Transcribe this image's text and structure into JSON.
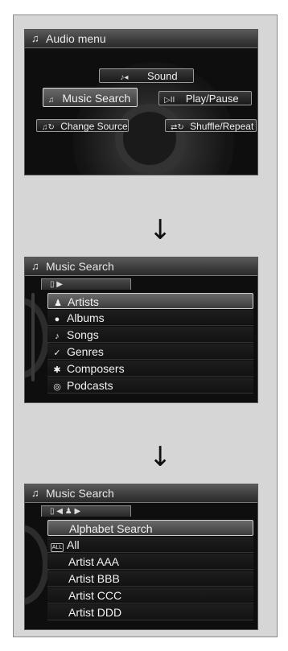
{
  "screen1": {
    "title": "Audio menu",
    "title_icon": "music-note-icon",
    "buttons": {
      "sound": {
        "label": "Sound",
        "icon": "♪◂"
      },
      "music_search": {
        "label": "Music Search",
        "icon": "♫"
      },
      "play_pause": {
        "label": "Play/Pause",
        "icon": "▷II"
      },
      "change_source": {
        "label": "Change Source",
        "icon": "♫↻"
      },
      "shuffle_repeat": {
        "label": "Shuffle/Repeat",
        "icon": "⇄↻"
      }
    }
  },
  "arrow1": "↓",
  "screen2": {
    "title": "Music Search",
    "title_icon": "music-note-icon",
    "tab_icon": "▯  ▶",
    "items": [
      {
        "label": "Artists",
        "icon": "♟"
      },
      {
        "label": "Albums",
        "icon": "●"
      },
      {
        "label": "Songs",
        "icon": "♪"
      },
      {
        "label": "Genres",
        "icon": "✓"
      },
      {
        "label": "Composers",
        "icon": "✱"
      },
      {
        "label": "Podcasts",
        "icon": "◎"
      }
    ]
  },
  "arrow2": "↓",
  "screen3": {
    "title": "Music Search",
    "title_icon": "music-note-icon",
    "tab_icon": "▯  ◀  ♟  ▶",
    "items": [
      {
        "label": "Alphabet Search",
        "icon": ""
      },
      {
        "label": "All",
        "icon": "ALL"
      },
      {
        "label": "Artist AAA",
        "icon": ""
      },
      {
        "label": "Artist BBB",
        "icon": ""
      },
      {
        "label": "Artist CCC",
        "icon": ""
      },
      {
        "label": "Artist DDD",
        "icon": ""
      }
    ]
  }
}
